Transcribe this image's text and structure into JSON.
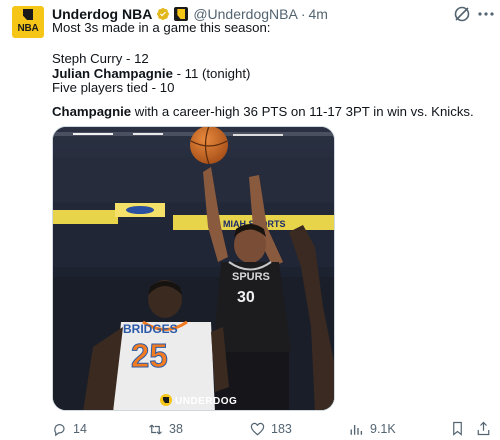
{
  "tweet": {
    "author_name": "Underdog NBA",
    "handle": "@UnderdogNBA",
    "separator": "·",
    "time": "4m",
    "avatar_text": "NBA",
    "lines": {
      "intro": "Most 3s made in a game this season:",
      "row1": "Steph Curry - 12",
      "row2_bold": "Julian Champagnie",
      "row2_rest": " - 11 (tonight)",
      "row3": "Five players tied - 10",
      "summary_bold": "Champagnie",
      "summary_rest": " with a career-high 36 PTS on 11-17 3PT in win vs. Knicks."
    }
  },
  "media": {
    "watermark": "UNDERDOG",
    "jersey_team_back": "BRIDGES",
    "jersey_number_back": "25",
    "jersey_team_front": "SPURS",
    "jersey_number_front": "30",
    "arena_sign": "MIAH SPORTS"
  },
  "actions": {
    "replies": "14",
    "reposts": "38",
    "likes": "183",
    "views": "9.1K"
  },
  "colors": {
    "brand_yellow": "#f5c518",
    "verified_gold": "#e2b719",
    "text_primary": "#0f1419",
    "text_secondary": "#536471"
  },
  "icons": [
    "verified-badge-icon",
    "affiliate-badge-icon",
    "grok-icon",
    "more-icon",
    "reply-icon",
    "repost-icon",
    "like-icon",
    "views-icon",
    "bookmark-icon",
    "share-icon"
  ]
}
